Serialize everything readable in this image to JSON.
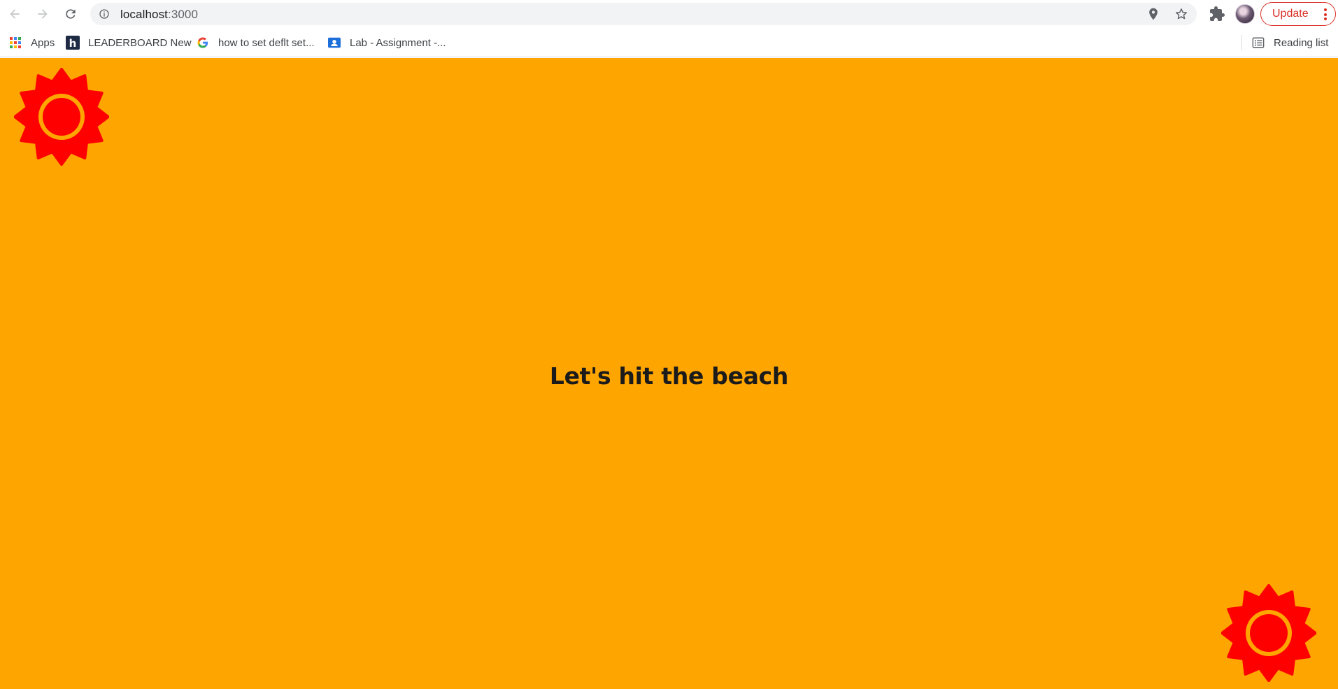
{
  "browser": {
    "url_host": "localhost",
    "url_port": ":3000",
    "update_label": "Update",
    "icons": {
      "back": "arrow-left-icon",
      "forward": "arrow-right-icon",
      "reload": "reload-icon",
      "site_info": "info-icon",
      "location": "location-pin-icon",
      "bookmark_star": "star-icon",
      "extensions": "puzzle-icon",
      "menu": "kebab-menu-icon"
    }
  },
  "bookmarks": {
    "items": [
      {
        "label": "Apps",
        "icon": "apps-grid-icon"
      },
      {
        "label": "LEADERBOARD New",
        "icon": "h-logo-icon"
      },
      {
        "label": "how to set deflt set...",
        "icon": "google-icon"
      },
      {
        "label": "Lab - Assignment -...",
        "icon": "classroom-icon"
      }
    ],
    "reading_list": {
      "label": "Reading list",
      "icon": "reading-list-icon"
    }
  },
  "page": {
    "heading": "Let's hit the beach",
    "background_color": "#ffa500",
    "sun_color": "#ff0000",
    "sun_icon": "sun-icon"
  }
}
